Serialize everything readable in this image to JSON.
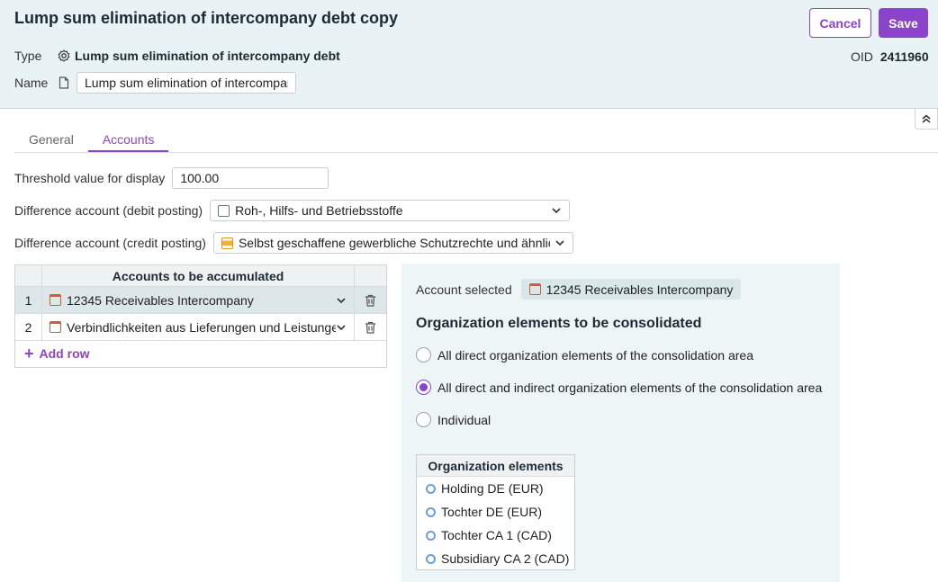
{
  "header": {
    "title": "Lump sum elimination of intercompany debt copy",
    "cancel_label": "Cancel",
    "save_label": "Save",
    "type_label": "Type",
    "type_value": "Lump sum elimination of intercompany debt",
    "name_label": "Name",
    "name_value": "Lump sum elimination of intercompany debt copy",
    "oid_label": "OID",
    "oid_value": "2411960"
  },
  "tabs": [
    {
      "label": "General",
      "active": false
    },
    {
      "label": "Accounts",
      "active": true
    }
  ],
  "form": {
    "threshold_label": "Threshold value for display",
    "threshold_value": "100.00",
    "debit_label": "Difference account (debit posting)",
    "debit_value": "Roh-, Hilfs- und Betriebsstoffe",
    "credit_label": "Difference account (credit posting)",
    "credit_value": "Selbst geschaffene gewerbliche Schutzrechte und ähnliche Rechte und Werte"
  },
  "accounts_table": {
    "header": "Accounts to be accumulated",
    "rows": [
      {
        "num": "1",
        "account": "12345 Receivables Intercompany"
      },
      {
        "num": "2",
        "account": "Verbindlichkeiten aus Lieferungen und Leistungen"
      }
    ],
    "add_row_label": "Add row"
  },
  "panel": {
    "account_selected_label": "Account selected",
    "account_selected_value": "12345 Receivables Intercompany",
    "org_title": "Organization elements to be consolidated",
    "options": [
      {
        "label": "All direct organization elements of the consolidation area",
        "checked": false
      },
      {
        "label": "All direct and indirect organization elements of the consolidation area",
        "checked": true
      },
      {
        "label": "Individual",
        "checked": false
      }
    ],
    "org_list_header": "Organization elements",
    "org_elements": [
      "Holding DE (EUR)",
      "Tochter DE (EUR)",
      "Tochter CA 1 (CAD)",
      "Subsidiary CA 2 (CAD)"
    ]
  },
  "colors": {
    "accent": "#8b44c9",
    "header_bg": "#e9f2f4",
    "panel_bg": "#eef5f6"
  }
}
